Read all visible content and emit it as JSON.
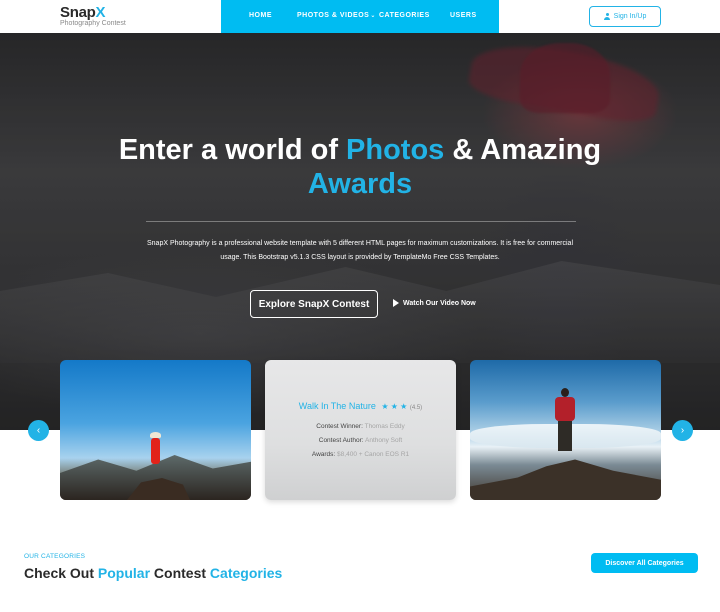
{
  "header": {
    "logo_title": "Snap",
    "logo_title_accent": "X",
    "logo_subtitle": "Photography Contest",
    "nav": [
      {
        "label": "HOME"
      },
      {
        "label": "PHOTOS & VIDEOS"
      },
      {
        "label": "CATEGORIES"
      },
      {
        "label": "USERS"
      }
    ],
    "signin_label": "Sign In/Up",
    "accent_color": "#22b3e6",
    "nav_bg_color": "#00bcf2"
  },
  "hero": {
    "title_part1": "Enter a world of ",
    "title_highlight1": "Photos",
    "title_part2": " & Amazing",
    "title_highlight2": "Awards",
    "description": "SnapX Photography is a professional website template with 5 different HTML pages for maximum customizations. It is free for commercial usage. This Bootstrap v5.1.3 CSS layout is provided by TemplateMo Free CSS Templates.",
    "explore_label": "Explore SnapX Contest",
    "watch_label": "Watch Our Video Now"
  },
  "contest_card": {
    "title": "Walk In The Nature",
    "stars": "★ ★ ★",
    "rating": "(4.5)",
    "winner_label": "Contest Winner:",
    "winner_value": "Thomas Eddy",
    "author_label": "Contest Author:",
    "author_value": "Anthony Soft",
    "awards_label": "Awards:",
    "awards_value": "$8,400 + Canon EOS R1"
  },
  "carousel": {
    "prev_icon": "‹",
    "next_icon": "›"
  },
  "categories": {
    "subtitle": "OUR CATEGORIES",
    "title_part1": "Check Out ",
    "title_highlight1": "Popular",
    "title_part2": " Contest ",
    "title_highlight2": "Categories",
    "discover_label": "Discover All Categories"
  }
}
